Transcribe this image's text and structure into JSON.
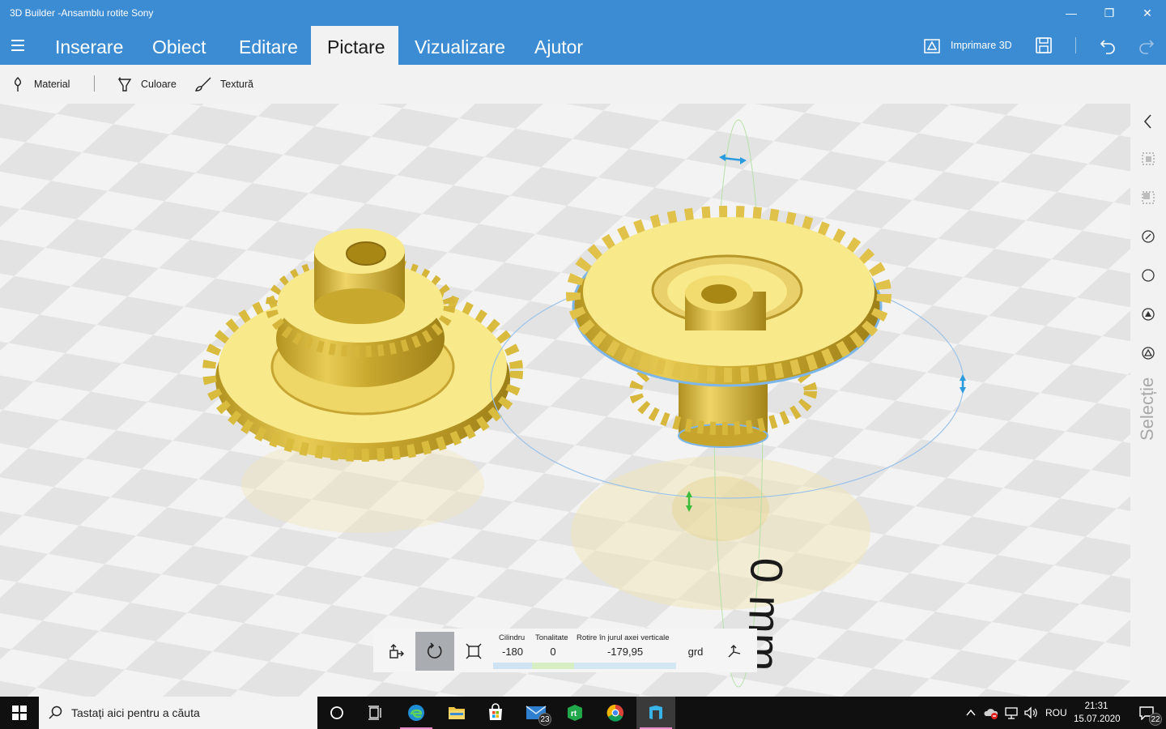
{
  "window": {
    "title": "3D Builder -Ansamblu rotite Sony",
    "minimize_glyph": "—",
    "maximize_glyph": "❐",
    "close_glyph": "✕"
  },
  "menu": {
    "tabs": [
      {
        "label": "Inserare",
        "active": false
      },
      {
        "label": "Obiect",
        "active": false
      },
      {
        "label": "Editare",
        "active": false
      },
      {
        "label": "Pictare",
        "active": true
      },
      {
        "label": "Vizualizare",
        "active": false
      },
      {
        "label": "Ajutor",
        "active": false
      }
    ],
    "print3d_label": "Imprimare 3D",
    "icons": [
      "hamburger-icon",
      "print3d-icon",
      "save-icon",
      "undo-icon",
      "redo-icon"
    ]
  },
  "ribbon": {
    "material_label": "Material",
    "color_label": "Culoare",
    "texture_label": "Textură"
  },
  "viewport": {
    "measure_label": "0 mm",
    "gear_color": "#f5e27a",
    "selection_outline_color": "#7fb6e8",
    "rotation_ring_color": "#9cc3ea"
  },
  "right_panel": {
    "selection_label": "Selecție",
    "icons": [
      "collapse-chevron-icon",
      "select-all-icon",
      "select-inverse-icon",
      "select-objects-icon",
      "select-faces-icon",
      "select-edges-icon",
      "select-vertices-icon"
    ]
  },
  "bottom_toolbar": {
    "cylinder_label": "Cilindru",
    "cylinder_value": "-180",
    "tilt_label": "Tonalitate",
    "tilt_value": "0",
    "rotation_label": "Rotire în jurul axei verticale",
    "rotation_value": "-179,95",
    "unit": "grd",
    "active_tool": "rotate"
  },
  "taskbar": {
    "search_placeholder": "Tastați aici pentru a căuta",
    "mail_badge": "23",
    "language": "ROU",
    "time": "21:31",
    "date": "15.07.2020",
    "notifications_count": "22"
  }
}
